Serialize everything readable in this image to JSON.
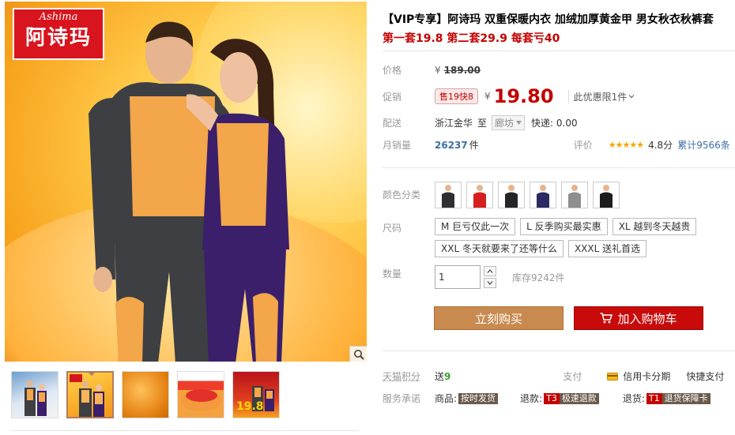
{
  "gallery": {
    "logo": {
      "script": "Ashima",
      "brand_cn": "阿诗玛"
    },
    "thumbnails": [
      {
        "name": "thumb-couple-snow"
      },
      {
        "name": "thumb-couple-yellow"
      },
      {
        "name": "thumb-fleece-closeup"
      },
      {
        "name": "thumb-fabric-roll"
      },
      {
        "name": "thumb-promo-banner",
        "badge": "19.8"
      }
    ]
  },
  "product": {
    "title": "【VIP专享】阿诗玛 双重保暖内衣 加绒加厚黄金甲 男女秋衣秋裤套",
    "promo": "第一套19.8 第二套29.9 每套亏40"
  },
  "price": {
    "label": "价格",
    "yen": "¥",
    "original": "189.00"
  },
  "promotion": {
    "label": "促销",
    "tag": "售19快8",
    "yen": "¥",
    "current": "19.80",
    "limit_text": "此优惠限1件"
  },
  "delivery": {
    "label": "配送",
    "from": "浙江金华",
    "to_word": "至",
    "to_city": "廊坊",
    "express": "快递: 0.00"
  },
  "sales": {
    "label": "月销量",
    "count": "26237",
    "unit": "件",
    "rating_label": "评价",
    "stars": "★★★★★",
    "score": "4.8分",
    "reviews": "累计9566条"
  },
  "color": {
    "label": "颜色分类",
    "swatches": [
      {
        "name": "swatch-black-man",
        "color": "#2f2f33"
      },
      {
        "name": "swatch-red-woman",
        "color": "#d61f1f"
      },
      {
        "name": "swatch-black-man-2",
        "color": "#252528"
      },
      {
        "name": "swatch-navy-woman",
        "color": "#2b2a63"
      },
      {
        "name": "swatch-grey-man",
        "color": "#8e8e8e"
      },
      {
        "name": "swatch-black-woman",
        "color": "#1c1c1c"
      }
    ]
  },
  "size": {
    "label": "尺码",
    "options": [
      "M 巨亏仅此一次",
      "L 反季购买最实惠",
      "XL 越到冬天越贵",
      "XXL 冬天就要来了还等什么",
      "XXXL 送礼首选"
    ]
  },
  "quantity": {
    "label": "数量",
    "value": "1",
    "stock": "库存9242件"
  },
  "actions": {
    "buy_now": "立刻购买",
    "add_to_cart": "加入购物车"
  },
  "footer": {
    "points_label": "天猫积分",
    "points_prefix": "送",
    "points_value": "9",
    "pay_label": "支付",
    "credit_card": "信用卡分期",
    "quick_pay": "快捷支付",
    "service_label": "服务承诺",
    "goods_prefix": "商品:",
    "goods_tag": "按时发货",
    "refund_prefix": "退款:",
    "refund_code": "T3",
    "refund_tag": "极速退款",
    "return_prefix": "退货:",
    "return_code": "T1",
    "return_tag": "退货保障卡"
  },
  "colors": {
    "accent_red": "#c40000",
    "buy_button": "#c88a4e",
    "cart_button": "#c80a0a"
  }
}
